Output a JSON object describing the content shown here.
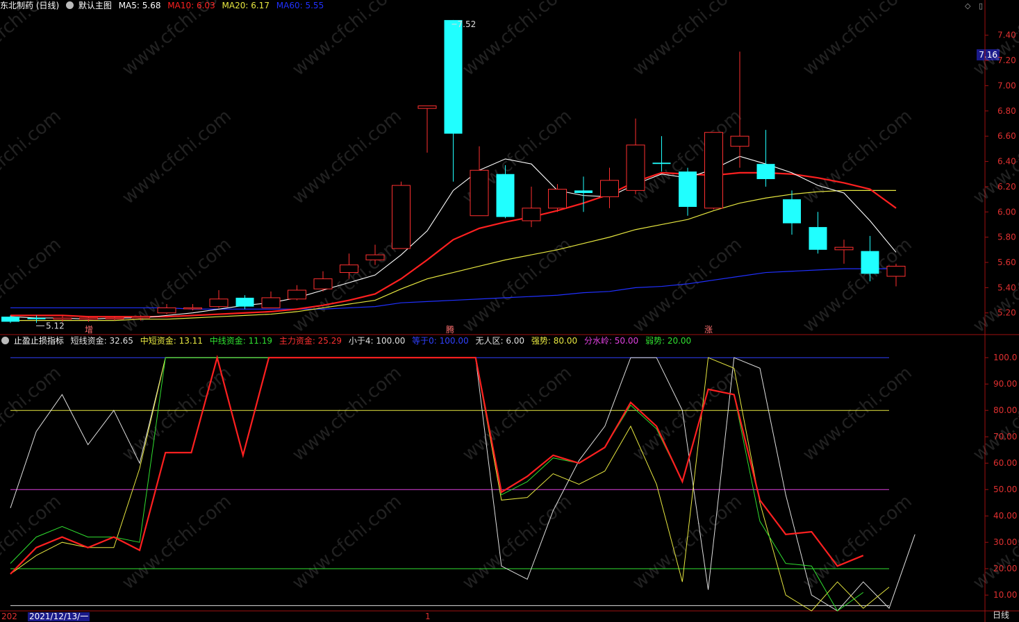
{
  "main": {
    "title": "东北制药 (日线)",
    "template": "默认主图",
    "ma5": "MA5: 5.68",
    "ma10": "MA10: 6.03",
    "ma20": "MA20: 6.17",
    "ma60": "MA60: 5.55",
    "high_label": "7.52",
    "low_label": "5.12",
    "price_tag": "7.16",
    "y_ticks": [
      "7.40",
      "7.20",
      "7.00",
      "6.80",
      "6.60",
      "6.40",
      "6.20",
      "6.00",
      "5.80",
      "5.60",
      "5.40",
      "5.20"
    ],
    "y_values": [
      7.4,
      7.2,
      7.0,
      6.8,
      6.6,
      6.4,
      6.2,
      6.0,
      5.8,
      5.6,
      5.4,
      5.2
    ],
    "markers": [
      "增",
      "腾",
      "涨"
    ],
    "watermark": "www.cfchi.com"
  },
  "sub": {
    "name": "止盈止损指标",
    "items": [
      {
        "label": "短线资金: 32.65",
        "color": "#e0e0e0"
      },
      {
        "label": "中短资金: 13.11",
        "color": "#e8e840"
      },
      {
        "label": "中线资金: 11.19",
        "color": "#30e030"
      },
      {
        "label": "主力资金: 25.29",
        "color": "#ff3030"
      },
      {
        "label": "小于4: 100.00",
        "color": "#e0e0e0"
      },
      {
        "label": "等于0: 100.00",
        "color": "#3040ff"
      },
      {
        "label": "无人区: 6.00",
        "color": "#e0e0e0"
      },
      {
        "label": "强势: 80.00",
        "color": "#e8e840"
      },
      {
        "label": "分水岭: 50.00",
        "color": "#e040e0"
      },
      {
        "label": "弱势: 20.00",
        "color": "#30e030"
      }
    ],
    "y_ticks": [
      "100.0",
      "90.00",
      "80.00",
      "70.00",
      "60.00",
      "50.00",
      "40.00",
      "30.00",
      "20.00",
      "10.00"
    ],
    "y_values": [
      100,
      90,
      80,
      70,
      60,
      50,
      40,
      30,
      20,
      10
    ]
  },
  "footer": {
    "date_prefix": "202",
    "date": "2021/12/13/一",
    "mid_mark": "1",
    "timeframe": "日线"
  },
  "colors": {
    "up": "#ff3030",
    "down": "#20ffff",
    "ma5": "#ffffff",
    "ma10": "#ff2020",
    "ma20": "#e8e840",
    "ma60": "#2030ff",
    "frame": "#a01010"
  },
  "chart_data": [
    {
      "type": "candlestick",
      "title": "东北制药 (日线)",
      "ylim": [
        5.05,
        7.58
      ],
      "candles": [
        {
          "o": 5.17,
          "c": 5.13,
          "h": 5.18,
          "l": 5.12
        },
        {
          "o": 5.16,
          "c": 5.15,
          "h": 5.18,
          "l": 5.12
        },
        {
          "o": 5.15,
          "c": 5.16,
          "h": 5.18,
          "l": 5.13
        },
        {
          "o": 5.15,
          "c": 5.16,
          "h": 5.17,
          "l": 5.13
        },
        {
          "o": 5.16,
          "c": 5.16,
          "h": 5.17,
          "l": 5.14
        },
        {
          "o": 5.16,
          "c": 5.17,
          "h": 5.18,
          "l": 5.14
        },
        {
          "o": 5.2,
          "c": 5.24,
          "h": 5.27,
          "l": 5.19
        },
        {
          "o": 5.24,
          "c": 5.24,
          "h": 5.27,
          "l": 5.22
        },
        {
          "o": 5.25,
          "c": 5.31,
          "h": 5.38,
          "l": 5.24
        },
        {
          "o": 5.32,
          "c": 5.25,
          "h": 5.34,
          "l": 5.23
        },
        {
          "o": 5.24,
          "c": 5.32,
          "h": 5.37,
          "l": 5.24
        },
        {
          "o": 5.31,
          "c": 5.38,
          "h": 5.42,
          "l": 5.3
        },
        {
          "o": 5.39,
          "c": 5.47,
          "h": 5.53,
          "l": 5.37
        },
        {
          "o": 5.52,
          "c": 5.58,
          "h": 5.67,
          "l": 5.47
        },
        {
          "o": 5.62,
          "c": 5.66,
          "h": 5.74,
          "l": 5.58
        },
        {
          "o": 5.71,
          "c": 6.21,
          "h": 6.24,
          "l": 5.71
        },
        {
          "o": 6.82,
          "c": 6.84,
          "h": 6.84,
          "l": 6.47
        },
        {
          "o": 7.52,
          "c": 6.62,
          "h": 7.52,
          "l": 6.24
        },
        {
          "o": 5.97,
          "c": 6.33,
          "h": 6.52,
          "l": 5.97
        },
        {
          "o": 6.3,
          "c": 5.96,
          "h": 6.37,
          "l": 5.95
        },
        {
          "o": 5.93,
          "c": 6.03,
          "h": 6.2,
          "l": 5.88
        },
        {
          "o": 6.03,
          "c": 6.18,
          "h": 6.22,
          "l": 6.0
        },
        {
          "o": 6.17,
          "c": 6.15,
          "h": 6.28,
          "l": 6.0
        },
        {
          "o": 6.12,
          "c": 6.25,
          "h": 6.35,
          "l": 6.03
        },
        {
          "o": 6.17,
          "c": 6.53,
          "h": 6.74,
          "l": 6.14
        },
        {
          "o": 6.39,
          "c": 6.38,
          "h": 6.6,
          "l": 6.32
        },
        {
          "o": 6.32,
          "c": 6.04,
          "h": 6.35,
          "l": 5.97
        },
        {
          "o": 6.03,
          "c": 6.63,
          "h": 6.63,
          "l": 6.02
        },
        {
          "o": 6.52,
          "c": 6.6,
          "h": 7.27,
          "l": 6.35
        },
        {
          "o": 6.38,
          "c": 6.26,
          "h": 6.65,
          "l": 6.2
        },
        {
          "o": 6.1,
          "c": 5.91,
          "h": 6.17,
          "l": 5.82
        },
        {
          "o": 5.88,
          "c": 5.7,
          "h": 6.0,
          "l": 5.67
        },
        {
          "o": 5.7,
          "c": 5.72,
          "h": 5.78,
          "l": 5.59
        },
        {
          "o": 5.69,
          "c": 5.51,
          "h": 5.81,
          "l": 5.45
        },
        {
          "o": 5.49,
          "c": 5.57,
          "h": 5.59,
          "l": 5.41
        }
      ],
      "ma5": [
        5.17,
        5.16,
        5.16,
        5.15,
        5.16,
        5.16,
        5.18,
        5.2,
        5.23,
        5.26,
        5.28,
        5.32,
        5.38,
        5.44,
        5.5,
        5.66,
        5.85,
        6.17,
        6.33,
        6.42,
        6.38,
        6.17,
        6.13,
        6.12,
        6.22,
        6.3,
        6.27,
        6.34,
        6.44,
        6.38,
        6.31,
        6.21,
        6.15,
        5.93,
        5.68
      ],
      "ma10": [
        5.18,
        5.18,
        5.18,
        5.17,
        5.17,
        5.17,
        5.17,
        5.18,
        5.19,
        5.2,
        5.21,
        5.23,
        5.26,
        5.3,
        5.35,
        5.47,
        5.62,
        5.78,
        5.87,
        5.92,
        5.96,
        6.01,
        6.07,
        6.14,
        6.24,
        6.31,
        6.3,
        6.29,
        6.31,
        6.31,
        6.3,
        6.27,
        6.23,
        6.18,
        6.03
      ],
      "ma20": [
        5.14,
        5.14,
        5.14,
        5.14,
        5.14,
        5.15,
        5.15,
        5.16,
        5.17,
        5.18,
        5.19,
        5.21,
        5.24,
        5.27,
        5.3,
        5.39,
        5.47,
        5.52,
        5.57,
        5.62,
        5.66,
        5.7,
        5.75,
        5.8,
        5.86,
        5.9,
        5.94,
        6.01,
        6.07,
        6.11,
        6.14,
        6.16,
        6.17,
        6.17,
        6.17
      ],
      "ma60": [
        5.24,
        5.24,
        5.24,
        5.24,
        5.24,
        5.24,
        5.24,
        5.23,
        5.23,
        5.23,
        5.23,
        5.23,
        5.23,
        5.24,
        5.25,
        5.28,
        5.29,
        5.3,
        5.31,
        5.32,
        5.33,
        5.34,
        5.36,
        5.37,
        5.4,
        5.41,
        5.43,
        5.46,
        5.49,
        5.52,
        5.53,
        5.54,
        5.55,
        5.55,
        5.55
      ]
    },
    {
      "type": "line",
      "title": "止盈止损指标",
      "ylim": [
        4,
        104
      ],
      "series": [
        {
          "name": "短线资金",
          "values": [
            43,
            72,
            86,
            67,
            80,
            60,
            100,
            100,
            100,
            100,
            100,
            100,
            100,
            100,
            100,
            100,
            100,
            100,
            100,
            21,
            16,
            42,
            61,
            74,
            100,
            100,
            80,
            12,
            100,
            96,
            48,
            10,
            4,
            15,
            5,
            33
          ]
        },
        {
          "name": "中短资金",
          "values": [
            18,
            25,
            30,
            28,
            28,
            58,
            100,
            100,
            100,
            100,
            100,
            100,
            100,
            100,
            100,
            100,
            100,
            100,
            100,
            46,
            47,
            56,
            52,
            57,
            74,
            52,
            15,
            100,
            96,
            45,
            10,
            4,
            15,
            5,
            13
          ]
        },
        {
          "name": "中线资金",
          "values": [
            22,
            32,
            36,
            32,
            32,
            30,
            100,
            100,
            100,
            100,
            100,
            100,
            100,
            100,
            100,
            100,
            100,
            100,
            100,
            48,
            53,
            62,
            60,
            66,
            82,
            73,
            53,
            88,
            86,
            38,
            22,
            21,
            4,
            11
          ]
        },
        {
          "name": "主力资金",
          "values": [
            18,
            28,
            32,
            28,
            32,
            27,
            64,
            64,
            100,
            63,
            100,
            100,
            100,
            100,
            100,
            100,
            100,
            100,
            100,
            49,
            55,
            63,
            60,
            66,
            83,
            74,
            53,
            88,
            86,
            46,
            33,
            34,
            21,
            25
          ]
        }
      ]
    }
  ]
}
